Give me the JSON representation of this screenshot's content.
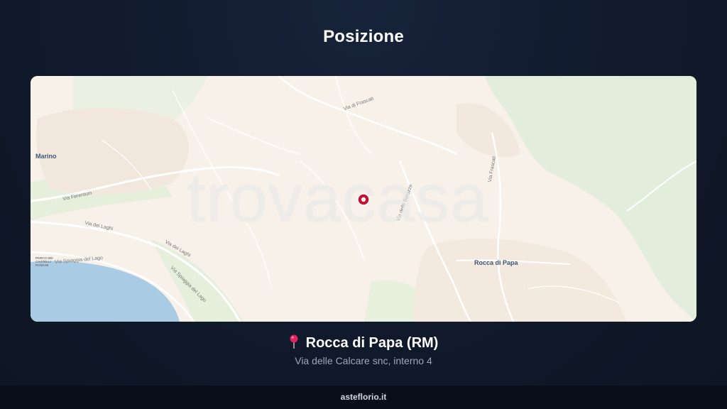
{
  "title": "Posizione",
  "map": {
    "watermark": "trovacasa",
    "places": {
      "marino": "Marino",
      "rocca_di_papa": "Rocca di Papa"
    },
    "roads": {
      "via_di_frascati": "Via di Frascati",
      "via_frascati": "Via Frascati",
      "via_ferentum": "Via Ferentum",
      "via_dei_laghi_1": "Via dei Laghi",
      "via_dei_laghi_2": "Via dei Laghi",
      "via_spiaggia_1": "Via Spiaggia del Lago",
      "via_spiaggia_2": "Via Spiaggia del Lago",
      "via_delle_barozze": "Via delle Barozze"
    },
    "park_label": "PARCO DEI CASTELLI ROMANI",
    "marker_icon": "location-marker-icon"
  },
  "location": {
    "pin_icon": "pushpin-icon",
    "name": "Rocca di Papa (RM)",
    "address": "Via delle Calcare snc, interno 4"
  },
  "footer": {
    "site": "asteflorio.it"
  },
  "colors": {
    "background": "#111a2c",
    "map_base": "#f7f1ea",
    "forest": "#e3eedb",
    "lake": "#a9cbe3",
    "marker": "#c8102e"
  }
}
